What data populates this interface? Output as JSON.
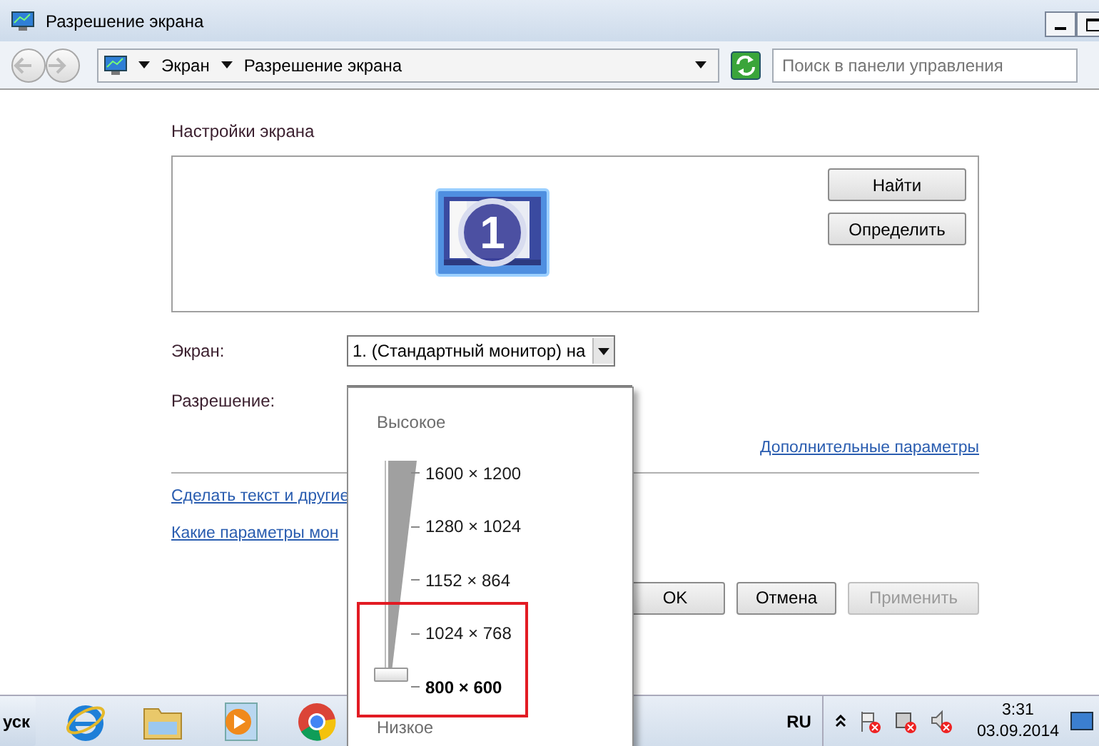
{
  "window": {
    "title": "Разрешение экрана"
  },
  "address_bar": {
    "breadcrumbs": [
      "Экран",
      "Разрешение экрана"
    ]
  },
  "search": {
    "placeholder": "Поиск в панели управления"
  },
  "heading": "Настройки экрана",
  "preview": {
    "display_number": "1",
    "buttons": [
      "Найти",
      "Определить"
    ]
  },
  "display_field": {
    "label": "Экран:",
    "value": "1. (Стандартный монитор) на"
  },
  "resolution_field": {
    "label": "Разрешение:"
  },
  "advanced_link": "Дополнительные параметры",
  "links": [
    "Сделать текст и другие",
    "Какие параметры мон"
  ],
  "dialog_buttons": [
    {
      "label": "OK",
      "disabled": false
    },
    {
      "label": "Отмена",
      "disabled": false
    },
    {
      "label": "Применить",
      "disabled": true
    }
  ],
  "resolution_popup": {
    "high_label": "Высокое",
    "low_label": "Низкое",
    "level": 0,
    "options": [
      {
        "label": "1600 × 1200",
        "selected": false
      },
      {
        "label": "1280 × 1024",
        "selected": false
      },
      {
        "label": "1152 × 864",
        "selected": false
      }
    ],
    "framed_options": [
      {
        "label": "1024 × 768",
        "selected": false
      },
      {
        "label": "800 × 600",
        "selected": true
      }
    ]
  },
  "taskbar": {
    "start_label": "уск",
    "language": "RU",
    "time": "3:31",
    "date": "03.09.2014"
  }
}
